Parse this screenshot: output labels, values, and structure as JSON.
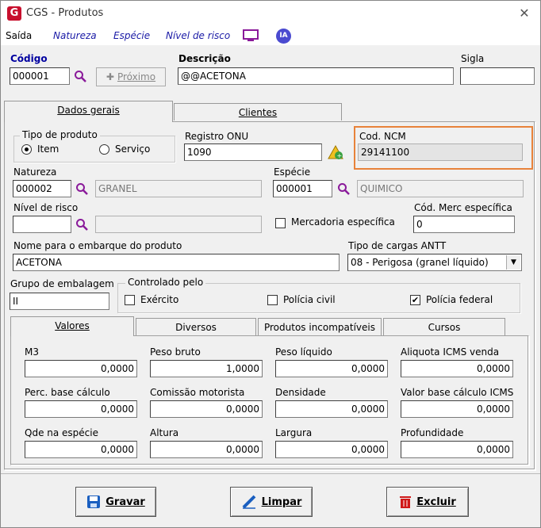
{
  "window": {
    "title": "CGS - Produtos",
    "close": "✕"
  },
  "menu": {
    "saida": "Saída",
    "natureza": "Natureza",
    "especie": "Espécie",
    "nivel": "Nível de risco",
    "ia": "IA"
  },
  "header": {
    "codigo_label": "Código",
    "codigo_value": "000001",
    "proximo_label": "Próximo",
    "descricao_label": "Descrição",
    "descricao_value": "@@ACETONA",
    "sigla_label": "Sigla",
    "sigla_value": ""
  },
  "tabs": {
    "dados": "Dados gerais",
    "clientes": "Clientes"
  },
  "tipo": {
    "title": "Tipo de produto",
    "item": "Item",
    "servico": "Serviço",
    "selected": "Item"
  },
  "onu": {
    "label": "Registro ONU",
    "value": "1090"
  },
  "ncm": {
    "label": "Cod. NCM",
    "value": "29141100",
    "highlight": "#e8823a"
  },
  "natureza": {
    "label": "Natureza",
    "code": "000002",
    "desc": "GRANEL"
  },
  "especie": {
    "label": "Espécie",
    "code": "000001",
    "desc": "QUIMICO"
  },
  "nivel": {
    "label": "Nível de risco",
    "code": "",
    "desc": ""
  },
  "merc": {
    "label": "Mercadoria específica",
    "checked": false
  },
  "codmerc": {
    "label": "Cód. Merc específica",
    "value": "0"
  },
  "embarque": {
    "label": "Nome para o embarque do produto",
    "value": "ACETONA"
  },
  "cargas": {
    "label": "Tipo de cargas ANTT",
    "value": "08 - Perigosa (granel líquido)"
  },
  "grupo": {
    "label": "Grupo de embalagem",
    "value": "II"
  },
  "controlado": {
    "title": "Controlado pelo",
    "exercito": "Exército",
    "civil": "Polícia civil",
    "federal": "Polícia federal",
    "exercito_checked": false,
    "civil_checked": false,
    "federal_checked": true,
    "check_mark": "✔"
  },
  "subtabs": {
    "valores": "Valores",
    "diversos": "Diversos",
    "incompat": "Produtos incompatíveis",
    "cursos": "Cursos"
  },
  "fields": [
    {
      "label": "M3",
      "value": "0,0000"
    },
    {
      "label": "Peso bruto",
      "value": "1,0000"
    },
    {
      "label": "Peso líquido",
      "value": "0,0000"
    },
    {
      "label": "Aliquota ICMS venda",
      "value": "0,0000"
    },
    {
      "label": "Perc. base cálculo",
      "value": "0,0000"
    },
    {
      "label": "Comissão motorista",
      "value": "0,0000"
    },
    {
      "label": "Densidade",
      "value": "0,0000"
    },
    {
      "label": "Valor base cálculo ICMS",
      "value": "0,0000"
    },
    {
      "label": "Qde na espécie",
      "value": "0,0000"
    },
    {
      "label": "Altura",
      "value": "0,0000"
    },
    {
      "label": "Largura",
      "value": "0,0000"
    },
    {
      "label": "Profundidade",
      "value": "0,0000"
    }
  ],
  "buttons": {
    "gravar": "Gravar",
    "limpar": "Limpar",
    "excluir": "Excluir"
  }
}
